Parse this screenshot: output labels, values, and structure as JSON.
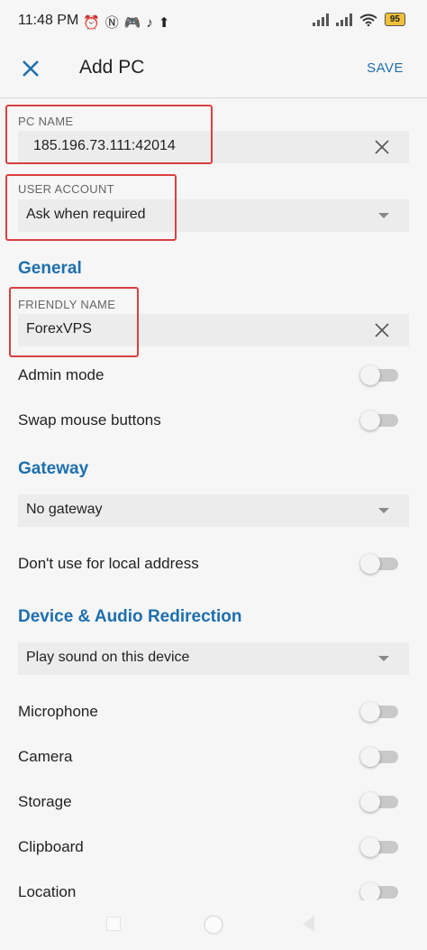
{
  "status_bar": {
    "time": "11:48 PM",
    "left_icons": [
      "alarm-icon",
      "nfc-icon",
      "game-icon",
      "tiktok-icon",
      "upload-icon"
    ],
    "battery": "95"
  },
  "app_bar": {
    "title": "Add PC",
    "save_label": "SAVE"
  },
  "pc_name": {
    "label": "PC NAME",
    "value": "185.196.73.111:42014"
  },
  "user_account": {
    "label": "USER ACCOUNT",
    "value": "Ask when required"
  },
  "general": {
    "heading": "General",
    "friendly_name_label": "FRIENDLY NAME",
    "friendly_name_value": "ForexVPS",
    "admin_mode": "Admin mode",
    "swap_mouse": "Swap mouse buttons"
  },
  "gateway": {
    "heading": "Gateway",
    "value": "No gateway",
    "local_address": "Don't use for local address"
  },
  "redirection": {
    "heading": "Device & Audio Redirection",
    "sound_value": "Play sound on this device",
    "microphone": "Microphone",
    "camera": "Camera",
    "storage": "Storage",
    "clipboard": "Clipboard",
    "location": "Location"
  },
  "colors": {
    "accent": "#1e6fae",
    "highlight": "#d94040"
  }
}
